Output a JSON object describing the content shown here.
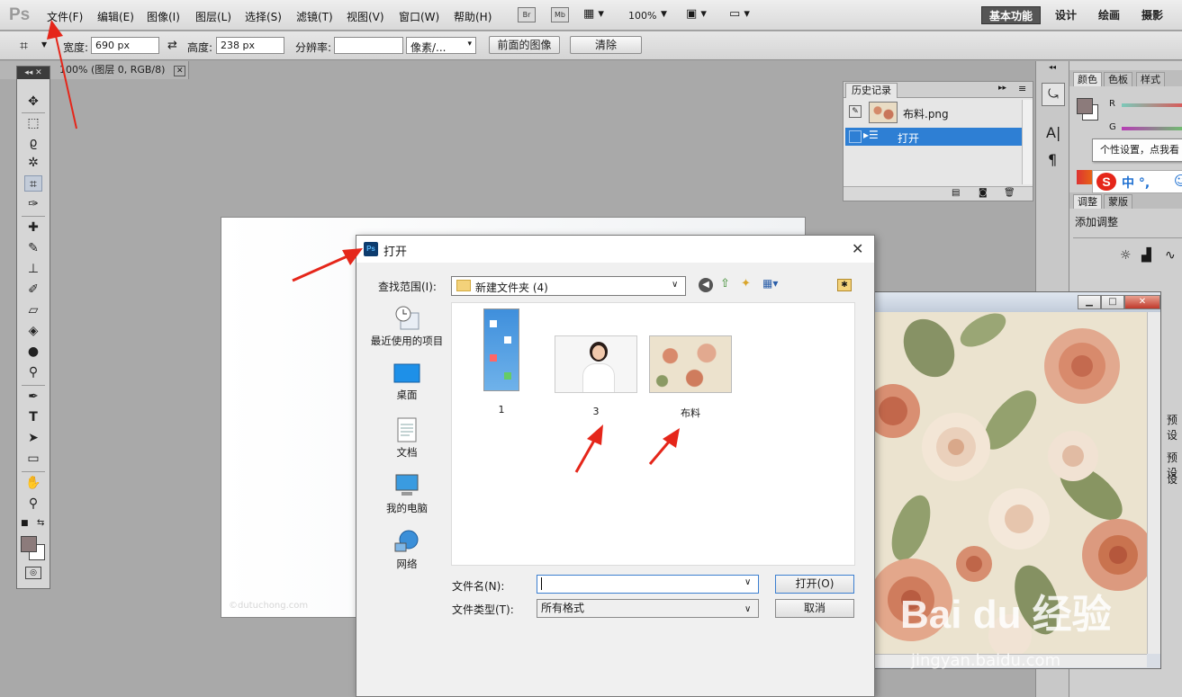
{
  "app": {
    "logo": "Ps"
  },
  "menu": [
    "文件(F)",
    "编辑(E)",
    "图像(I)",
    "图层(L)",
    "选择(S)",
    "滤镜(T)",
    "视图(V)",
    "窗口(W)",
    "帮助(H)"
  ],
  "menubar_tools": {
    "br": "Br",
    "mb": "Mb",
    "zoom": "100%"
  },
  "workspaces": [
    "基本功能",
    "设计",
    "绘画",
    "摄影"
  ],
  "options": {
    "width_label": "宽度:",
    "width_value": "690 px",
    "height_label": "高度:",
    "height_value": "238 px",
    "resolution_label": "分辨率:",
    "resolution_value": "",
    "unit": "像素/...",
    "front_image": "前面的图像",
    "clear": "清除"
  },
  "document_tab": "100% (图层 0, RGB/8)",
  "canvas_watermark": "©dutuchong.com",
  "history": {
    "tab": "历史记录",
    "snapshot": "布料.png",
    "step": "打开"
  },
  "dock": {
    "tabs_top": [
      "颜色",
      "色板",
      "样式"
    ],
    "r_label": "R",
    "g_label": "G",
    "tabs_mid": [
      "调整",
      "蒙版"
    ],
    "add_adjustment": "添加调整",
    "side_labels": [
      "预设",
      "预设",
      "设"
    ],
    "ime_tip": "个性设置，点我看",
    "ime_chars": "中 °,"
  },
  "dialog": {
    "title": "打开",
    "look_in_label": "查找范围(I):",
    "look_in_value": "新建文件夹 (4)",
    "places": [
      "最近使用的项目",
      "桌面",
      "文档",
      "我的电脑",
      "网络"
    ],
    "files": [
      "1",
      "3",
      "布料"
    ],
    "filename_label": "文件名(N):",
    "filename_value": "",
    "filetype_label": "文件类型(T):",
    "filetype_value": "所有格式",
    "open_button": "打开(O)",
    "cancel_button": "取消"
  },
  "watermark": {
    "brand": "Bai du 经验",
    "url": "jingyan.baidu.com"
  },
  "colors": {
    "accent": "#2e7fd4",
    "arrow": "#e5261a",
    "foreground": "#8c7b7b"
  }
}
